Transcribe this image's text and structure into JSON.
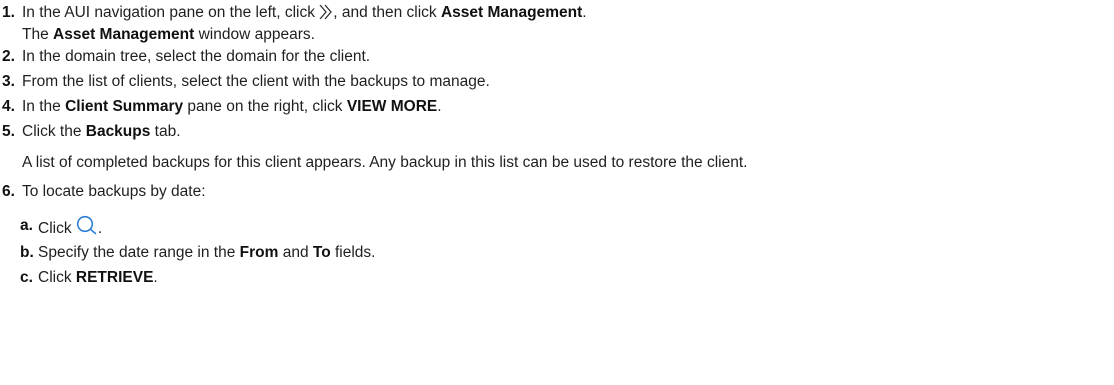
{
  "steps": [
    {
      "num": "1.",
      "t1": "In the AUI navigation pane on the left, click ",
      "icon": "double-chevron-right-icon",
      "t2": ", and then click ",
      "b1": "Asset Management",
      "t3": ".",
      "result_t1": "The ",
      "result_b1": "Asset Management",
      "result_t2": " window appears."
    },
    {
      "num": "2.",
      "text": "In the domain tree, select the domain for the client."
    },
    {
      "num": "3.",
      "text": "From the list of clients, select the client with the backups to manage."
    },
    {
      "num": "4.",
      "t1": "In the ",
      "b1": "Client Summary",
      "t2": " pane on the right, click ",
      "b2": "VIEW MORE",
      "t3": "."
    },
    {
      "num": "5.",
      "t1": "Click the ",
      "b1": "Backups",
      "t2": " tab.",
      "result": "A list of completed backups for this client appears. Any backup in this list can be used to restore the client."
    },
    {
      "num": "6.",
      "text": "To locate backups by date:",
      "substeps": [
        {
          "num": "a.",
          "t1": "Click ",
          "icon": "search-icon",
          "t2": "."
        },
        {
          "num": "b.",
          "t1": "Specify the date range in the ",
          "b1": "From",
          "t2": " and ",
          "b2": "To",
          "t3": " fields."
        },
        {
          "num": "c.",
          "t1": "Click ",
          "b1": "RETRIEVE",
          "t2": "."
        }
      ]
    }
  ],
  "colors": {
    "text": "#1f1f1f",
    "icon": "#2c7fd6"
  }
}
